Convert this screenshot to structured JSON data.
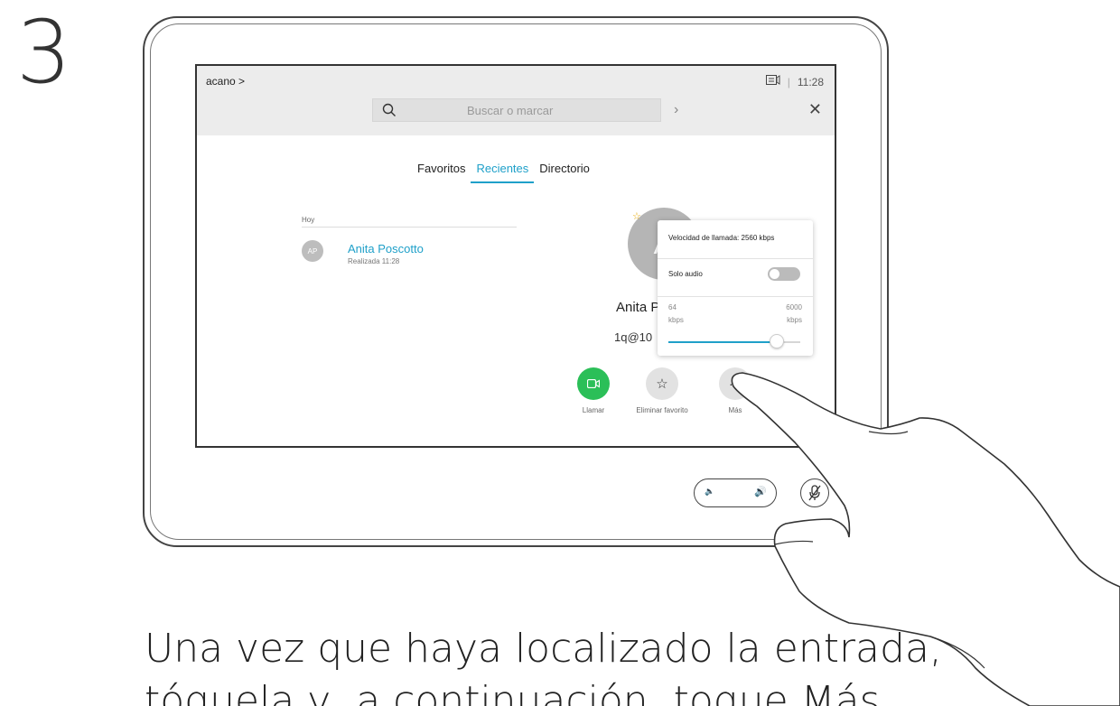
{
  "step": "3",
  "device": {
    "topbar": {
      "breadcrumb": "acano >",
      "time": "11:28",
      "separator": "|",
      "search_placeholder": "Buscar o marcar",
      "forward_icon": "chevron-right-icon",
      "close_icon": "close-icon"
    },
    "tabs": [
      {
        "label": "Favoritos",
        "active": false
      },
      {
        "label": "Recientes",
        "active": true
      },
      {
        "label": "Directorio",
        "active": false
      }
    ],
    "recents": {
      "section": "Hoy",
      "items": [
        {
          "initials": "AP",
          "name": "Anita Poscotto",
          "detail": "Realizada 11:28"
        }
      ]
    },
    "contact_detail": {
      "avatar_initial": "A",
      "name": "Anita P",
      "address": "1q@10"
    },
    "popover": {
      "title": "Velocidad de llamada: 2560 kbps",
      "audio_only_label": "Solo audio",
      "audio_only": false,
      "min_value": "64",
      "min_unit": "kbps",
      "max_value": "6000",
      "max_unit": "kbps",
      "rate_fraction": 0.82
    },
    "actions": [
      {
        "label": "Llamar"
      },
      {
        "label": "Eliminar favorito"
      },
      {
        "label": "Más"
      }
    ]
  },
  "colors": {
    "accent": "#1fa0c9",
    "call_green": "#2bbf58",
    "favorite_star": "#e6a800"
  },
  "caption": {
    "line1": "Una vez que haya localizado la entrada,",
    "line2": "tóquela y, a continuación, toque Más."
  }
}
